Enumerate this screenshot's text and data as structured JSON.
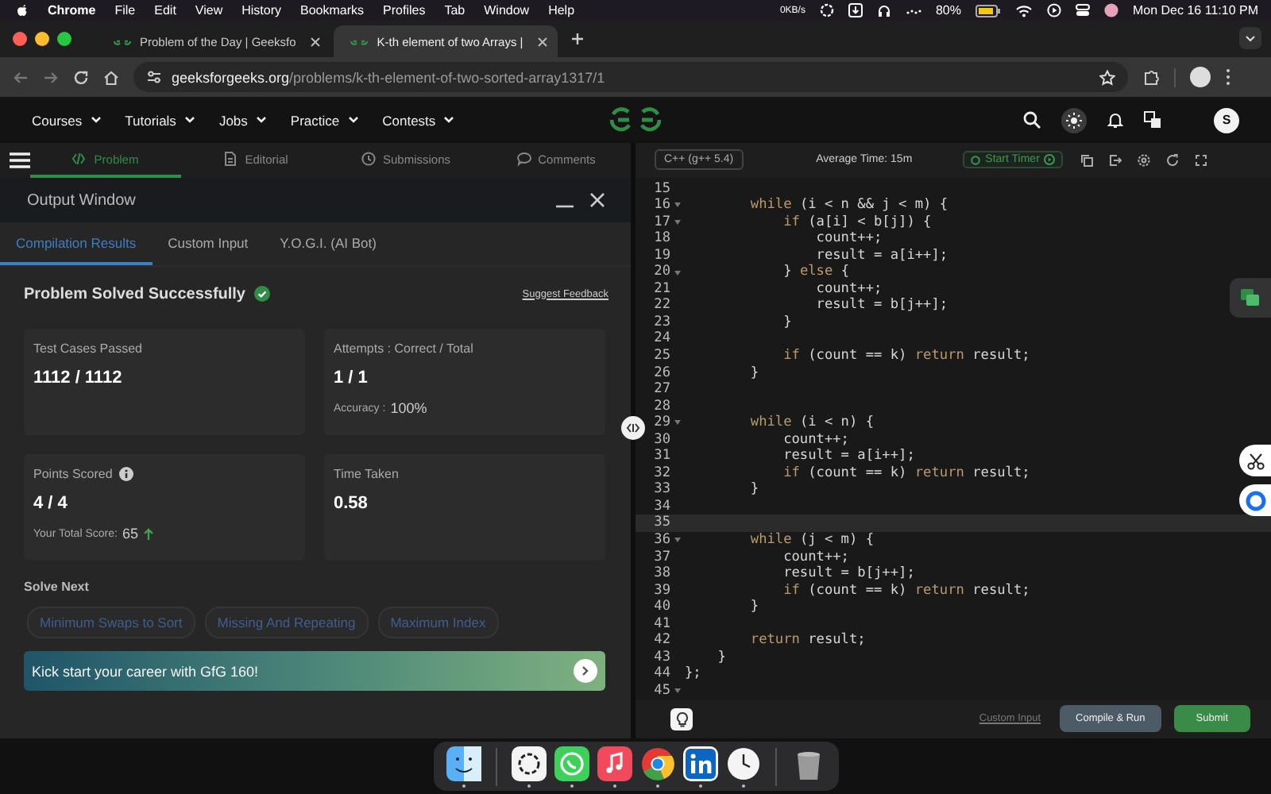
{
  "menubar": {
    "app": "Chrome",
    "menus": [
      "File",
      "Edit",
      "View",
      "History",
      "Bookmarks",
      "Profiles",
      "Tab",
      "Window",
      "Help"
    ],
    "network": "0KB/s",
    "battery": "80%",
    "clock": "Mon Dec 16  11:10 PM"
  },
  "browser": {
    "tabs": [
      {
        "title": "Problem of the Day | Geeksfo",
        "selected": false
      },
      {
        "title": "K-th element of two Arrays |",
        "selected": true
      }
    ],
    "url_host": "geeksforgeeks.org",
    "url_path": "/problems/k-th-element-of-two-sorted-array1317/1"
  },
  "nav": {
    "menus": [
      "Courses",
      "Tutorials",
      "Jobs",
      "Practice",
      "Contests"
    ],
    "avatar": "S"
  },
  "problem_tabs": [
    {
      "kind": "code",
      "label": "Problem",
      "selected": true
    },
    {
      "kind": "document",
      "label": "Editorial",
      "selected": false
    },
    {
      "kind": "clock",
      "label": "Submissions",
      "selected": false
    },
    {
      "kind": "comment",
      "label": "Comments",
      "selected": false
    }
  ],
  "output_window": {
    "title": "Output Window",
    "tabs": [
      {
        "label": "Compilation Results",
        "selected": true
      },
      {
        "label": "Custom Input",
        "selected": false
      },
      {
        "label": "Y.O.G.I. (AI Bot)",
        "selected": false
      }
    ],
    "status": "Problem Solved Successfully",
    "feedback_link": "Suggest Feedback",
    "cards": [
      {
        "label": "Test Cases Passed",
        "info": false,
        "value": "1112 / 1112"
      },
      {
        "label": "Attempts : Correct / Total",
        "info": false,
        "value": "1 / 1",
        "detail_label": "Accuracy :",
        "detail_value": "100%"
      },
      {
        "label": "Points Scored",
        "info": true,
        "value": "4 / 4",
        "detail_label": "Your Total Score:",
        "detail_value": "65",
        "trend_up": true
      },
      {
        "label": "Time Taken",
        "info": false,
        "value": "0.58"
      }
    ],
    "solve_next": {
      "title": "Solve Next",
      "problems": [
        "Minimum Swaps to Sort",
        "Missing And Repeating",
        "Maximum Index"
      ]
    },
    "banner": "Kick start your career with GfG 160!"
  },
  "editor": {
    "language": "C++ (g++ 5.4)",
    "average_time": "Average Time: 15m",
    "timer_button": "Start Timer",
    "custom_input_link": "Custom Input",
    "run_button": "Compile & Run",
    "submit_button": "Submit",
    "lines": [
      {
        "number": "15",
        "foldable": false,
        "current": false
      },
      {
        "number": "16",
        "foldable": true,
        "current": false,
        "tokens": [
          {
            "kind": "keyword",
            "text": "        while"
          },
          {
            "kind": "plain",
            "text": " (i < n && j < m) {"
          }
        ]
      },
      {
        "number": "17",
        "foldable": true,
        "current": false,
        "tokens": [
          {
            "kind": "keyword",
            "text": "            if"
          },
          {
            "kind": "plain",
            "text": " (a[i] < b[j]) {"
          }
        ]
      },
      {
        "number": "18",
        "foldable": false,
        "current": false,
        "tokens": [
          {
            "kind": "plain",
            "text": "                count++;"
          }
        ]
      },
      {
        "number": "19",
        "foldable": false,
        "current": false,
        "tokens": [
          {
            "kind": "plain",
            "text": "                result = a[i++];"
          }
        ]
      },
      {
        "number": "20",
        "foldable": true,
        "current": false,
        "tokens": [
          {
            "kind": "plain",
            "text": "            } "
          },
          {
            "kind": "keyword",
            "text": "else"
          },
          {
            "kind": "plain",
            "text": " {"
          }
        ]
      },
      {
        "number": "21",
        "foldable": false,
        "current": false,
        "tokens": [
          {
            "kind": "plain",
            "text": "                count++;"
          }
        ]
      },
      {
        "number": "22",
        "foldable": false,
        "current": false,
        "tokens": [
          {
            "kind": "plain",
            "text": "                result = b[j++];"
          }
        ]
      },
      {
        "number": "23",
        "foldable": false,
        "current": false,
        "tokens": [
          {
            "kind": "plain",
            "text": "            }"
          }
        ]
      },
      {
        "number": "24",
        "foldable": false,
        "current": false
      },
      {
        "number": "25",
        "foldable": false,
        "current": false,
        "tokens": [
          {
            "kind": "keyword",
            "text": "            if"
          },
          {
            "kind": "plain",
            "text": " (count == k) "
          },
          {
            "kind": "keyword",
            "text": "return"
          },
          {
            "kind": "plain",
            "text": " result;"
          }
        ]
      },
      {
        "number": "26",
        "foldable": false,
        "current": false,
        "tokens": [
          {
            "kind": "plain",
            "text": "        }"
          }
        ]
      },
      {
        "number": "27",
        "foldable": false,
        "current": false
      },
      {
        "number": "28",
        "foldable": false,
        "current": false
      },
      {
        "number": "29",
        "foldable": true,
        "current": false,
        "tokens": [
          {
            "kind": "keyword",
            "text": "        while"
          },
          {
            "kind": "plain",
            "text": " (i < n) {"
          }
        ]
      },
      {
        "number": "30",
        "foldable": false,
        "current": false,
        "tokens": [
          {
            "kind": "plain",
            "text": "            count++;"
          }
        ]
      },
      {
        "number": "31",
        "foldable": false,
        "current": false,
        "tokens": [
          {
            "kind": "plain",
            "text": "            result = a[i++];"
          }
        ]
      },
      {
        "number": "32",
        "foldable": false,
        "current": false,
        "tokens": [
          {
            "kind": "keyword",
            "text": "            if"
          },
          {
            "kind": "plain",
            "text": " (count == k) "
          },
          {
            "kind": "keyword",
            "text": "return"
          },
          {
            "kind": "plain",
            "text": " result;"
          }
        ]
      },
      {
        "number": "33",
        "foldable": false,
        "current": false,
        "tokens": [
          {
            "kind": "plain",
            "text": "        }"
          }
        ]
      },
      {
        "number": "34",
        "foldable": false,
        "current": false
      },
      {
        "number": "35",
        "foldable": false,
        "current": true
      },
      {
        "number": "36",
        "foldable": true,
        "current": false,
        "tokens": [
          {
            "kind": "keyword",
            "text": "        while"
          },
          {
            "kind": "plain",
            "text": " (j < m) {"
          }
        ]
      },
      {
        "number": "37",
        "foldable": false,
        "current": false,
        "tokens": [
          {
            "kind": "plain",
            "text": "            count++;"
          }
        ]
      },
      {
        "number": "38",
        "foldable": false,
        "current": false,
        "tokens": [
          {
            "kind": "plain",
            "text": "            result = b[j++];"
          }
        ]
      },
      {
        "number": "39",
        "foldable": false,
        "current": false,
        "tokens": [
          {
            "kind": "keyword",
            "text": "            if"
          },
          {
            "kind": "plain",
            "text": " (count == k) "
          },
          {
            "kind": "keyword",
            "text": "return"
          },
          {
            "kind": "plain",
            "text": " result;"
          }
        ]
      },
      {
        "number": "40",
        "foldable": false,
        "current": false,
        "tokens": [
          {
            "kind": "plain",
            "text": "        }"
          }
        ]
      },
      {
        "number": "41",
        "foldable": false,
        "current": false
      },
      {
        "number": "42",
        "foldable": false,
        "current": false,
        "tokens": [
          {
            "kind": "keyword",
            "text": "        return"
          },
          {
            "kind": "plain",
            "text": " result;"
          }
        ]
      },
      {
        "number": "43",
        "foldable": false,
        "current": false,
        "tokens": [
          {
            "kind": "plain",
            "text": "    }"
          }
        ]
      },
      {
        "number": "44",
        "foldable": false,
        "current": false,
        "tokens": [
          {
            "kind": "plain",
            "text": "};"
          }
        ]
      },
      {
        "number": "45",
        "foldable": true,
        "current": false
      }
    ]
  },
  "dock": {
    "apps": [
      {
        "kind": "finder",
        "running": true
      },
      {
        "kind": "knot",
        "running": true
      },
      {
        "kind": "chat",
        "running": true
      },
      {
        "kind": "music",
        "running": true
      },
      {
        "kind": "browser",
        "running": true
      },
      {
        "kind": "in-logo",
        "running": true
      },
      {
        "kind": "clock",
        "running": true
      },
      {
        "kind": "trash",
        "running": false
      }
    ]
  }
}
